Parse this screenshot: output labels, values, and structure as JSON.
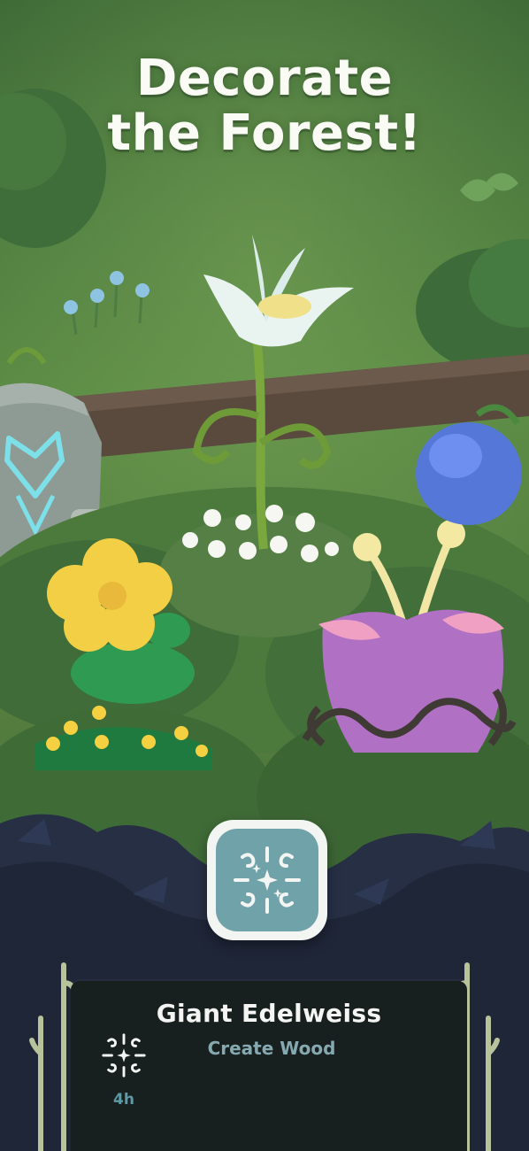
{
  "headline": {
    "line1": "Decorate",
    "line2": "the Forest!"
  },
  "selected_plant": {
    "name": "Giant Edelweiss",
    "action": "Create Wood",
    "duration": "4h",
    "icon": "sparkle-swirl-icon"
  },
  "colors": {
    "forest_bg": "#4f7a3c",
    "panel_bg": "#17201f",
    "badge_teal": "#70a2aa",
    "accent_blue": "#5e9aa5",
    "subtitle_blue": "#86a8b1"
  }
}
